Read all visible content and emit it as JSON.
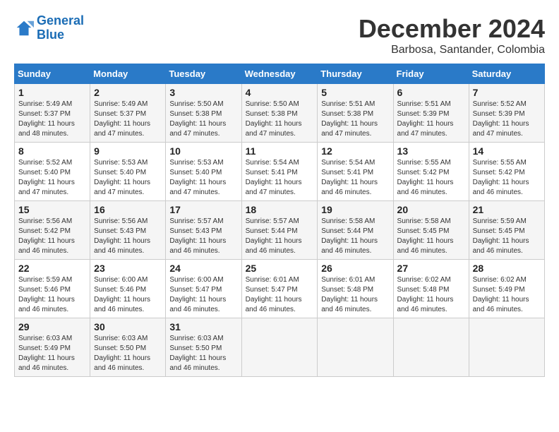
{
  "header": {
    "logo_line1": "General",
    "logo_line2": "Blue",
    "month": "December 2024",
    "location": "Barbosa, Santander, Colombia"
  },
  "weekdays": [
    "Sunday",
    "Monday",
    "Tuesday",
    "Wednesday",
    "Thursday",
    "Friday",
    "Saturday"
  ],
  "weeks": [
    [
      {
        "day": "1",
        "info": "Sunrise: 5:49 AM\nSunset: 5:37 PM\nDaylight: 11 hours and 48 minutes."
      },
      {
        "day": "2",
        "info": "Sunrise: 5:49 AM\nSunset: 5:37 PM\nDaylight: 11 hours and 47 minutes."
      },
      {
        "day": "3",
        "info": "Sunrise: 5:50 AM\nSunset: 5:38 PM\nDaylight: 11 hours and 47 minutes."
      },
      {
        "day": "4",
        "info": "Sunrise: 5:50 AM\nSunset: 5:38 PM\nDaylight: 11 hours and 47 minutes."
      },
      {
        "day": "5",
        "info": "Sunrise: 5:51 AM\nSunset: 5:38 PM\nDaylight: 11 hours and 47 minutes."
      },
      {
        "day": "6",
        "info": "Sunrise: 5:51 AM\nSunset: 5:39 PM\nDaylight: 11 hours and 47 minutes."
      },
      {
        "day": "7",
        "info": "Sunrise: 5:52 AM\nSunset: 5:39 PM\nDaylight: 11 hours and 47 minutes."
      }
    ],
    [
      {
        "day": "8",
        "info": "Sunrise: 5:52 AM\nSunset: 5:40 PM\nDaylight: 11 hours and 47 minutes."
      },
      {
        "day": "9",
        "info": "Sunrise: 5:53 AM\nSunset: 5:40 PM\nDaylight: 11 hours and 47 minutes."
      },
      {
        "day": "10",
        "info": "Sunrise: 5:53 AM\nSunset: 5:40 PM\nDaylight: 11 hours and 47 minutes."
      },
      {
        "day": "11",
        "info": "Sunrise: 5:54 AM\nSunset: 5:41 PM\nDaylight: 11 hours and 47 minutes."
      },
      {
        "day": "12",
        "info": "Sunrise: 5:54 AM\nSunset: 5:41 PM\nDaylight: 11 hours and 46 minutes."
      },
      {
        "day": "13",
        "info": "Sunrise: 5:55 AM\nSunset: 5:42 PM\nDaylight: 11 hours and 46 minutes."
      },
      {
        "day": "14",
        "info": "Sunrise: 5:55 AM\nSunset: 5:42 PM\nDaylight: 11 hours and 46 minutes."
      }
    ],
    [
      {
        "day": "15",
        "info": "Sunrise: 5:56 AM\nSunset: 5:42 PM\nDaylight: 11 hours and 46 minutes."
      },
      {
        "day": "16",
        "info": "Sunrise: 5:56 AM\nSunset: 5:43 PM\nDaylight: 11 hours and 46 minutes."
      },
      {
        "day": "17",
        "info": "Sunrise: 5:57 AM\nSunset: 5:43 PM\nDaylight: 11 hours and 46 minutes."
      },
      {
        "day": "18",
        "info": "Sunrise: 5:57 AM\nSunset: 5:44 PM\nDaylight: 11 hours and 46 minutes."
      },
      {
        "day": "19",
        "info": "Sunrise: 5:58 AM\nSunset: 5:44 PM\nDaylight: 11 hours and 46 minutes."
      },
      {
        "day": "20",
        "info": "Sunrise: 5:58 AM\nSunset: 5:45 PM\nDaylight: 11 hours and 46 minutes."
      },
      {
        "day": "21",
        "info": "Sunrise: 5:59 AM\nSunset: 5:45 PM\nDaylight: 11 hours and 46 minutes."
      }
    ],
    [
      {
        "day": "22",
        "info": "Sunrise: 5:59 AM\nSunset: 5:46 PM\nDaylight: 11 hours and 46 minutes."
      },
      {
        "day": "23",
        "info": "Sunrise: 6:00 AM\nSunset: 5:46 PM\nDaylight: 11 hours and 46 minutes."
      },
      {
        "day": "24",
        "info": "Sunrise: 6:00 AM\nSunset: 5:47 PM\nDaylight: 11 hours and 46 minutes."
      },
      {
        "day": "25",
        "info": "Sunrise: 6:01 AM\nSunset: 5:47 PM\nDaylight: 11 hours and 46 minutes."
      },
      {
        "day": "26",
        "info": "Sunrise: 6:01 AM\nSunset: 5:48 PM\nDaylight: 11 hours and 46 minutes."
      },
      {
        "day": "27",
        "info": "Sunrise: 6:02 AM\nSunset: 5:48 PM\nDaylight: 11 hours and 46 minutes."
      },
      {
        "day": "28",
        "info": "Sunrise: 6:02 AM\nSunset: 5:49 PM\nDaylight: 11 hours and 46 minutes."
      }
    ],
    [
      {
        "day": "29",
        "info": "Sunrise: 6:03 AM\nSunset: 5:49 PM\nDaylight: 11 hours and 46 minutes."
      },
      {
        "day": "30",
        "info": "Sunrise: 6:03 AM\nSunset: 5:50 PM\nDaylight: 11 hours and 46 minutes."
      },
      {
        "day": "31",
        "info": "Sunrise: 6:03 AM\nSunset: 5:50 PM\nDaylight: 11 hours and 46 minutes."
      },
      null,
      null,
      null,
      null
    ]
  ]
}
